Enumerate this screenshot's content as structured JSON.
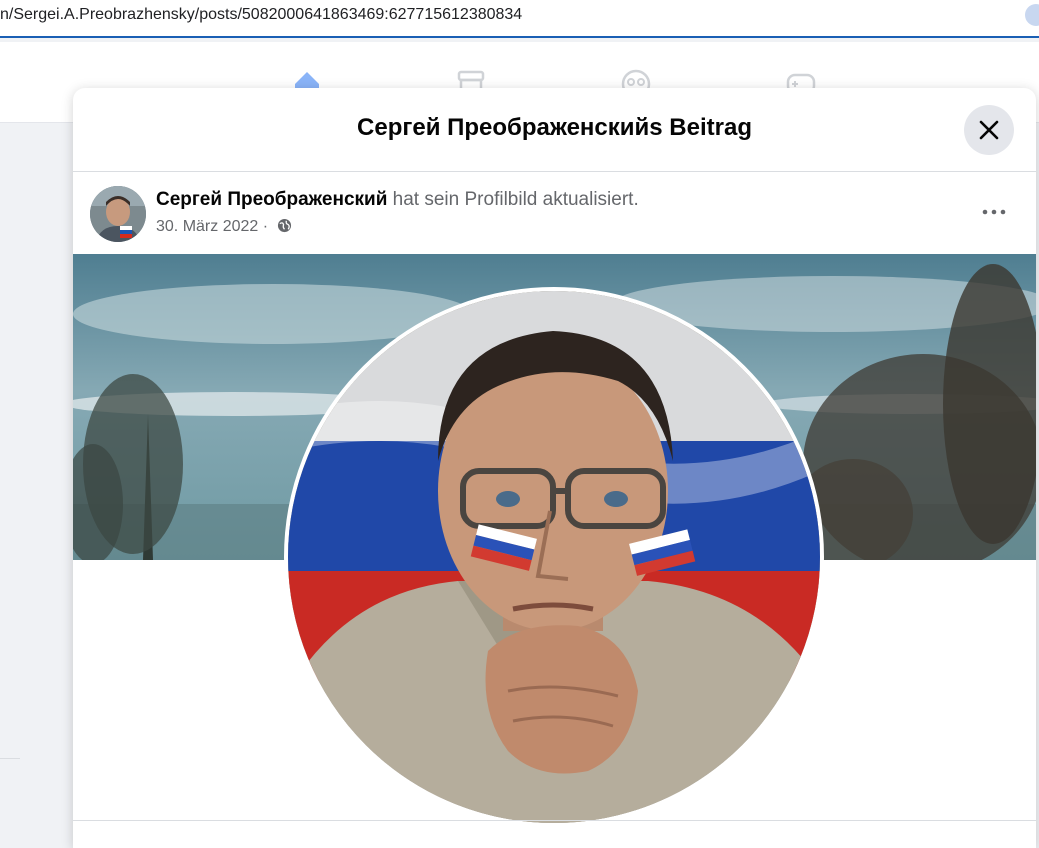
{
  "browser": {
    "url": "n/Sergei.A.Preobrazhensky/posts/5082000641863469:627715612380834"
  },
  "nav": {
    "icons": [
      "home-icon",
      "marketplace-icon",
      "groups-icon",
      "gaming-icon"
    ]
  },
  "modal": {
    "title": "Сергей Преображенскийs Beitrag",
    "close_icon": "close-icon"
  },
  "post": {
    "author": "Сергей Преображенский",
    "action": "hat sein Profilbild aktualisiert.",
    "date": "30. März 2022",
    "separator": "·",
    "audience_icon": "globe-icon",
    "more_icon": "more-horizontal-icon"
  },
  "colors": {
    "accent": "#1877f2",
    "nav_icon": "#bcc0c4",
    "header_border": "#dadde1",
    "text_secondary": "#65676b"
  }
}
